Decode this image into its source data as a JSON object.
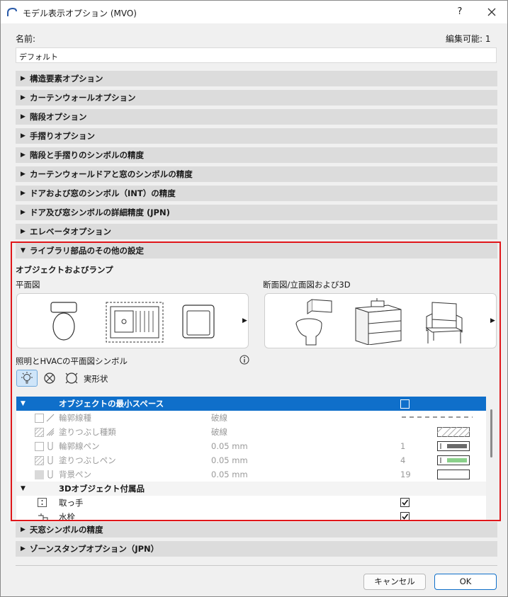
{
  "window": {
    "title": "モデル表示オプション (MVO)",
    "help": "?",
    "close": "✕"
  },
  "name_label": "名前:",
  "editable_label": "編集可能: 1",
  "name_value": "デフォルト",
  "sections_top": [
    {
      "label": "構造要素オプション"
    },
    {
      "label": "カーテンウォールオプション"
    },
    {
      "label": "階段オプション"
    },
    {
      "label": "手摺りオプション"
    },
    {
      "label": "階段と手摺りのシンボルの精度"
    },
    {
      "label": "カーテンウォールドアと窓のシンボルの精度"
    },
    {
      "label": "ドアおよび窓のシンボル（INT）の精度"
    },
    {
      "label": "ドア及び窓シンボルの詳細精度 (JPN)"
    },
    {
      "label": "エレベータオプション"
    }
  ],
  "library_section": {
    "label": "ライブラリ部品のその他の設定",
    "objects_heading": "オブジェクトおよびランプ",
    "floor_plan_label": "平面図",
    "section_label": "断面図/立面図および3D",
    "hvac_label": "照明とHVACの平面図シンボル",
    "real_shape_label": "実形状",
    "table": {
      "header": "オブジェクトの最小スペース",
      "rows": [
        {
          "name": "輪郭線種",
          "value": "破線",
          "num": ""
        },
        {
          "name": "塗りつぶし種類",
          "value": "破線",
          "num": ""
        },
        {
          "name": "輪郭線ペン",
          "value": "0.05 mm",
          "num": "1"
        },
        {
          "name": "塗りつぶしペン",
          "value": "0.05 mm",
          "num": "4"
        },
        {
          "name": "背景ペン",
          "value": "0.05 mm",
          "num": "19"
        }
      ],
      "group": "3Dオブジェクト付属品",
      "group_rows": [
        {
          "name": "取っ手"
        },
        {
          "name": "水栓"
        }
      ]
    }
  },
  "sections_bottom": [
    {
      "label": "天窓シンボルの精度"
    },
    {
      "label": "ゾーンスタンプオプション（JPN）"
    }
  ],
  "buttons": {
    "cancel": "キャンセル",
    "ok": "OK"
  },
  "colors": {
    "accent": "#0f6fca",
    "highlight": "#e0161a",
    "pen_1": "#6a6a6a",
    "pen_4": "#8ad08a"
  }
}
